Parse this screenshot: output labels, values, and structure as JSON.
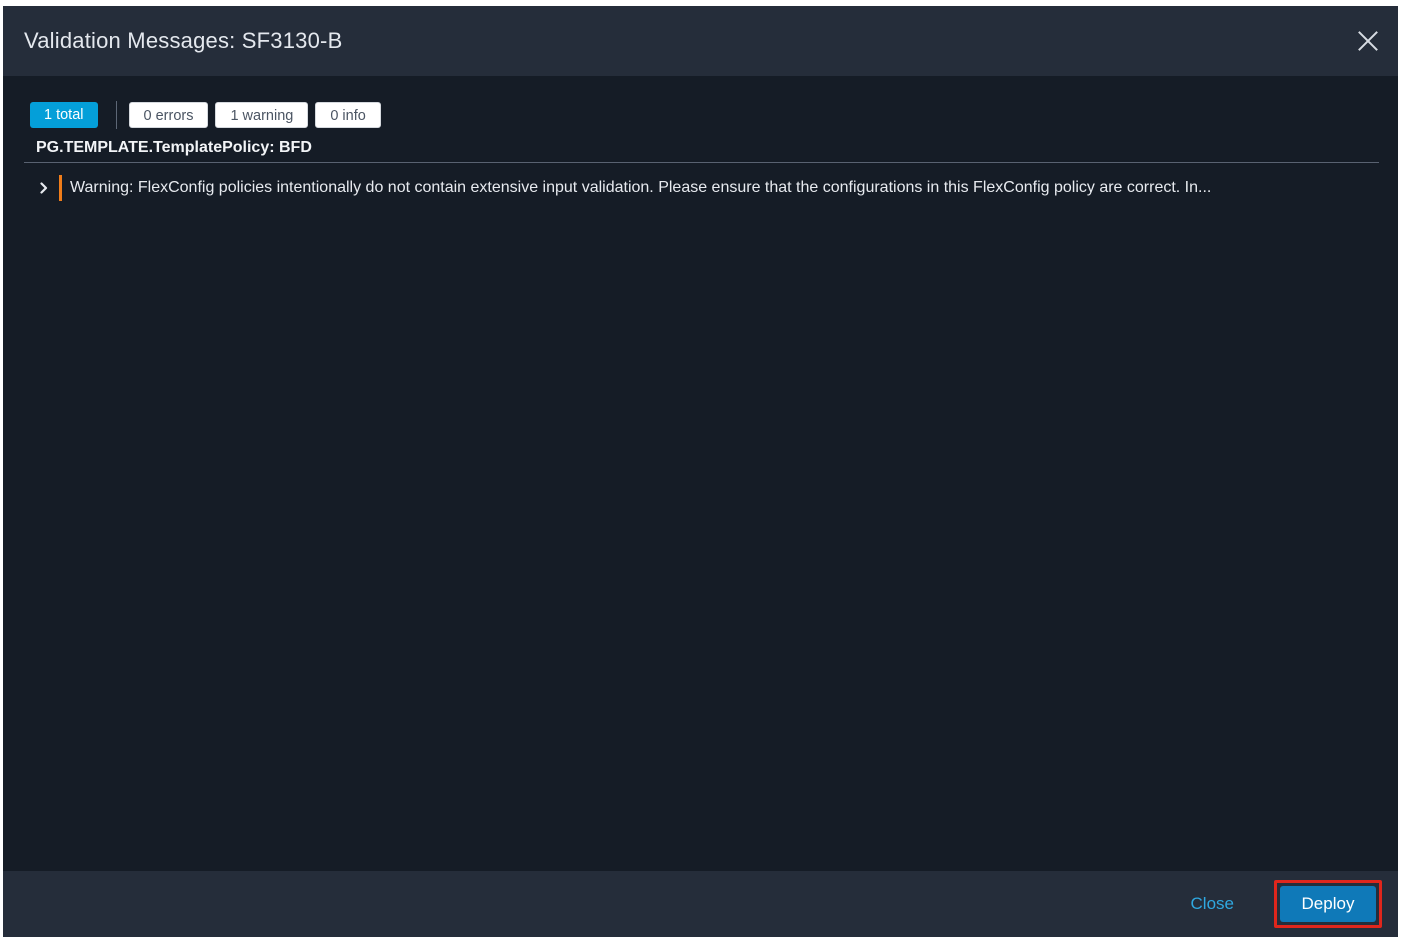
{
  "dialog": {
    "title": "Validation Messages: SF3130-B",
    "close_icon": "close-icon"
  },
  "filters": {
    "total": "1 total",
    "errors": "0 errors",
    "warnings": "1 warning",
    "info": "0 info",
    "active": "total"
  },
  "group": {
    "title": "PG.TEMPLATE.TemplatePolicy: BFD",
    "messages": [
      {
        "severity": "warning",
        "text": "Warning: FlexConfig policies intentionally do not contain extensive input validation. Please ensure that the configurations in this FlexConfig policy are correct. In..."
      }
    ]
  },
  "footer": {
    "close_label": "Close",
    "deploy_label": "Deploy"
  },
  "colors": {
    "accent": "#049fd9",
    "warning": "#f07d1a",
    "highlight": "#e0261c"
  }
}
